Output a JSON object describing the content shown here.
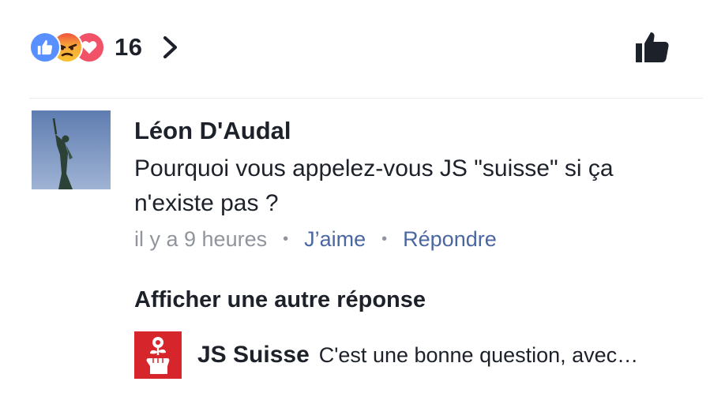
{
  "reactions": {
    "types": [
      "like",
      "angry",
      "love"
    ],
    "count": "16",
    "colors": {
      "like": "#5890ff",
      "angry": "#f7a83a",
      "love": "#f25268"
    }
  },
  "comment": {
    "author": "Léon D'Audal",
    "text": "Pourquoi vous appelez-vous JS \"suisse\" si ça n'existe pas ?",
    "timestamp": "il y a 9 heures",
    "like_label": "J’aime",
    "reply_label": "Répondre"
  },
  "more_replies_label": "Afficher une autre réponse",
  "reply_preview": {
    "author": "JS Suisse",
    "text": "C'est une bonne question, avec…"
  },
  "icons": {
    "like_reaction": "thumbs-up-icon",
    "angry_reaction": "angry-face-icon",
    "love_reaction": "heart-icon",
    "chevron": "chevron-right-icon",
    "like_action": "thumbs-up-icon"
  },
  "colors": {
    "link": "#4b67a1",
    "muted": "#90949c",
    "text": "#1d2129",
    "reply_avatar_bg": "#d7262b"
  }
}
